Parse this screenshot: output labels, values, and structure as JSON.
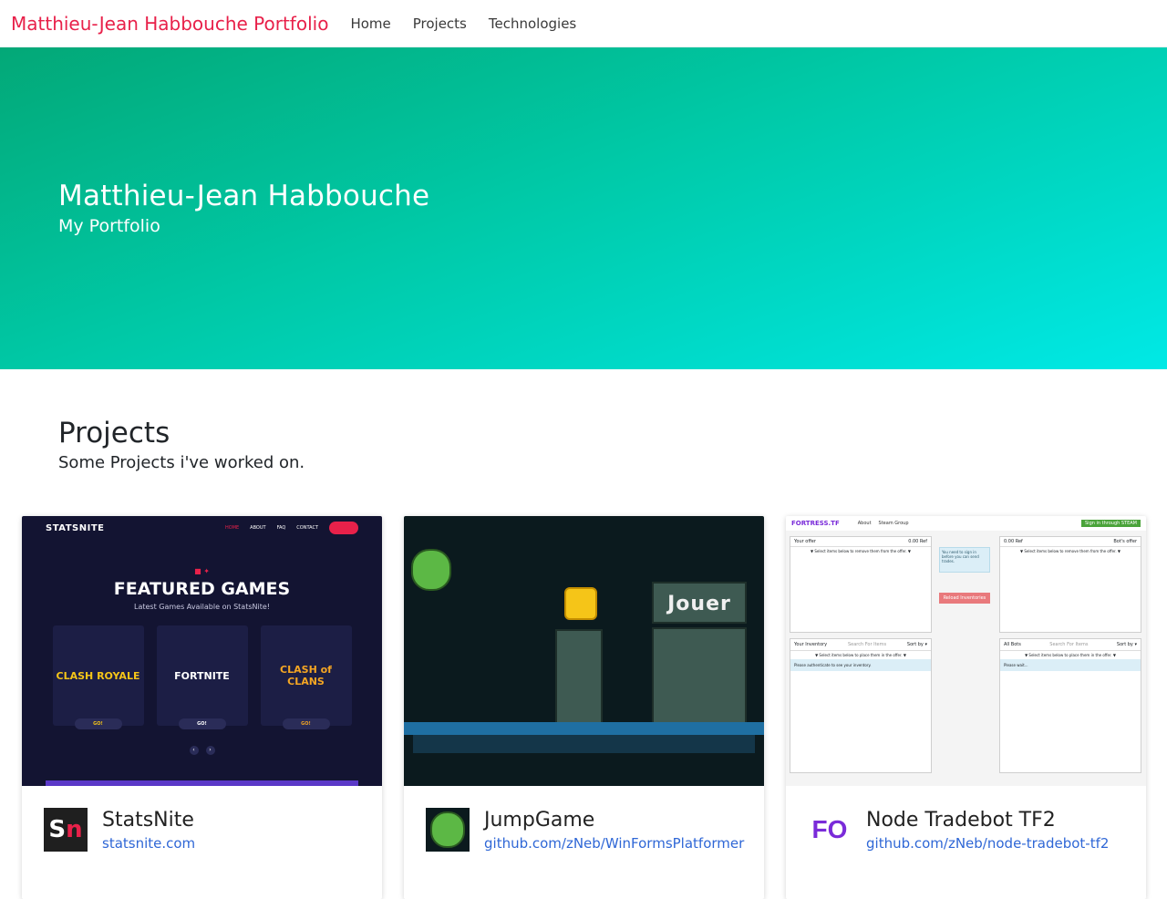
{
  "nav": {
    "brand": "Matthieu-Jean Habbouche Portfolio",
    "links": [
      "Home",
      "Projects",
      "Technologies"
    ]
  },
  "hero": {
    "title": "Matthieu-Jean Habbouche",
    "subtitle": "My Portfolio"
  },
  "projects": {
    "title": "Projects",
    "subtitle": "Some Projects i've worked on.",
    "cards": [
      {
        "name": "StatsNite",
        "link": "statsnite.com",
        "thumb": {
          "logo": "STATSNITE",
          "menu": [
            "HOME",
            "ABOUT",
            "FAQ",
            "CONTACT"
          ],
          "headline": "FEATURED GAMES",
          "tagline": "Latest Games Available on StatsNite!",
          "games": [
            "CLASH ROYALE",
            "FORTNITE",
            "CLASH of CLANS"
          ],
          "go": "GO!"
        },
        "logo_text_a": "S",
        "logo_text_b": "n"
      },
      {
        "name": "JumpGame",
        "link": "github.com/zNeb/WinFormsPlatformer",
        "thumb": {
          "button": "Jouer"
        }
      },
      {
        "name": "Node Tradebot TF2",
        "link": "github.com/zNeb/node-tradebot-tf2",
        "thumb": {
          "logo": "FORTRESS.TF",
          "menu": [
            "About",
            "Steam Group"
          ],
          "steam": "Sign in through STEAM",
          "your_offer": "Your offer",
          "bots_offer": "Bot's offer",
          "ref": "0.00 Ref",
          "select_remove": "▼ Select items below to remove them from the offer. ▼",
          "select_place": "▼ Select items below to place them in the offer. ▼",
          "sign_in_note": "You need to sign in before you can send trades.",
          "reload": "Reload Inventories",
          "your_inventory": "Your Inventory",
          "search": "Search For Items",
          "sort": "Sort by ▾",
          "all_bots": "All Bots",
          "please_auth": "Please authenticate to see your inventory.",
          "please_wait": "Please wait..."
        },
        "logo_text": "FO"
      }
    ]
  }
}
